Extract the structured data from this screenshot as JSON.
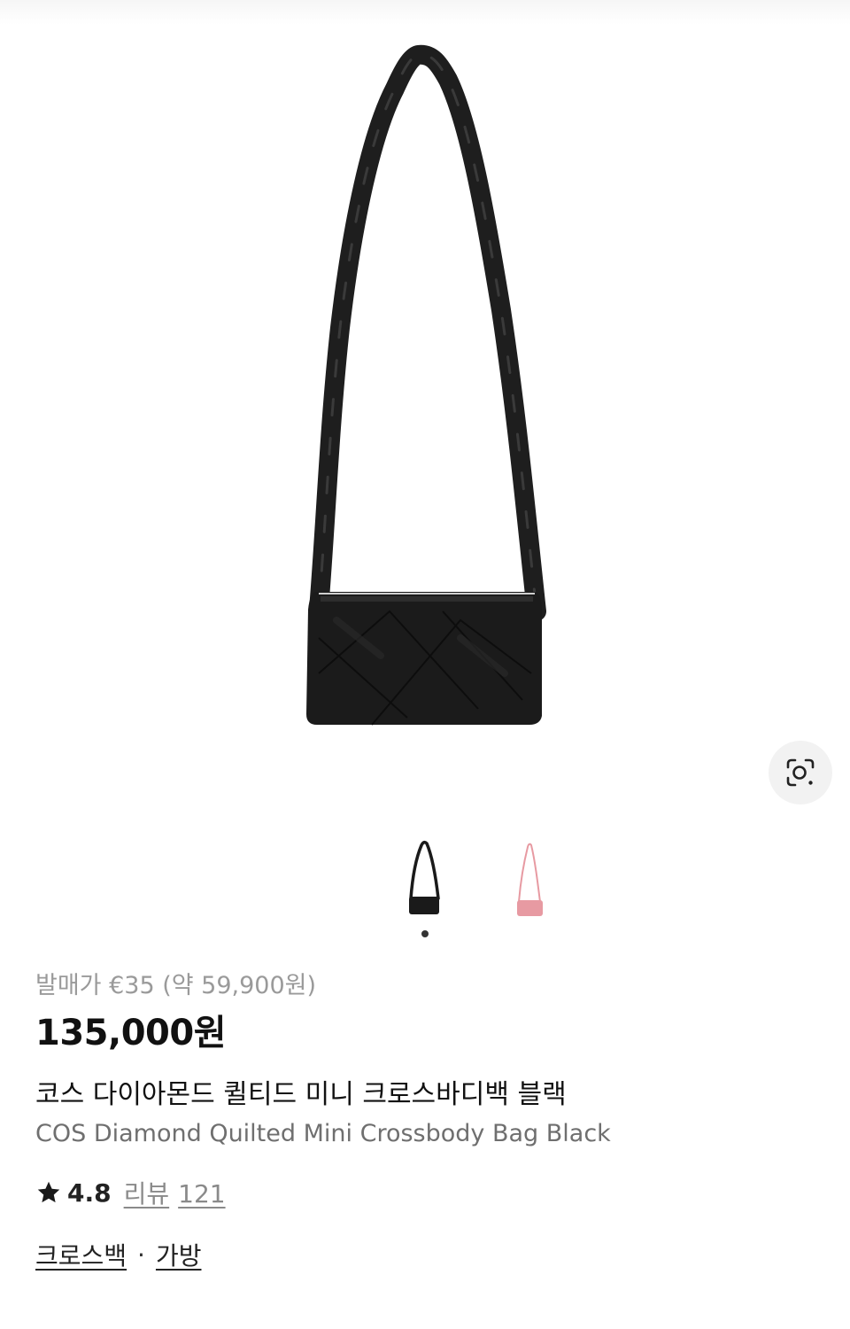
{
  "product": {
    "release_price": "발매가 €35 (약 59,900원)",
    "price": "135,000원",
    "name_ko": "코스 다이아몬드 퀼티드 미니 크로스바디백 블랙",
    "name_en": "COS Diamond Quilted Mini Crossbody Bag Black"
  },
  "rating": {
    "score": "4.8",
    "review_label": "리뷰",
    "review_count": "121"
  },
  "categories": {
    "primary": "크로스백",
    "separator": "·",
    "secondary": "가방"
  },
  "gallery": {
    "current_index": 1,
    "total": 2,
    "thumbnails": [
      {
        "color": "#1a1a1a"
      },
      {
        "color": "#e79aa2"
      }
    ]
  },
  "icons": {
    "lens": "image-search-icon",
    "star": "star-icon"
  }
}
